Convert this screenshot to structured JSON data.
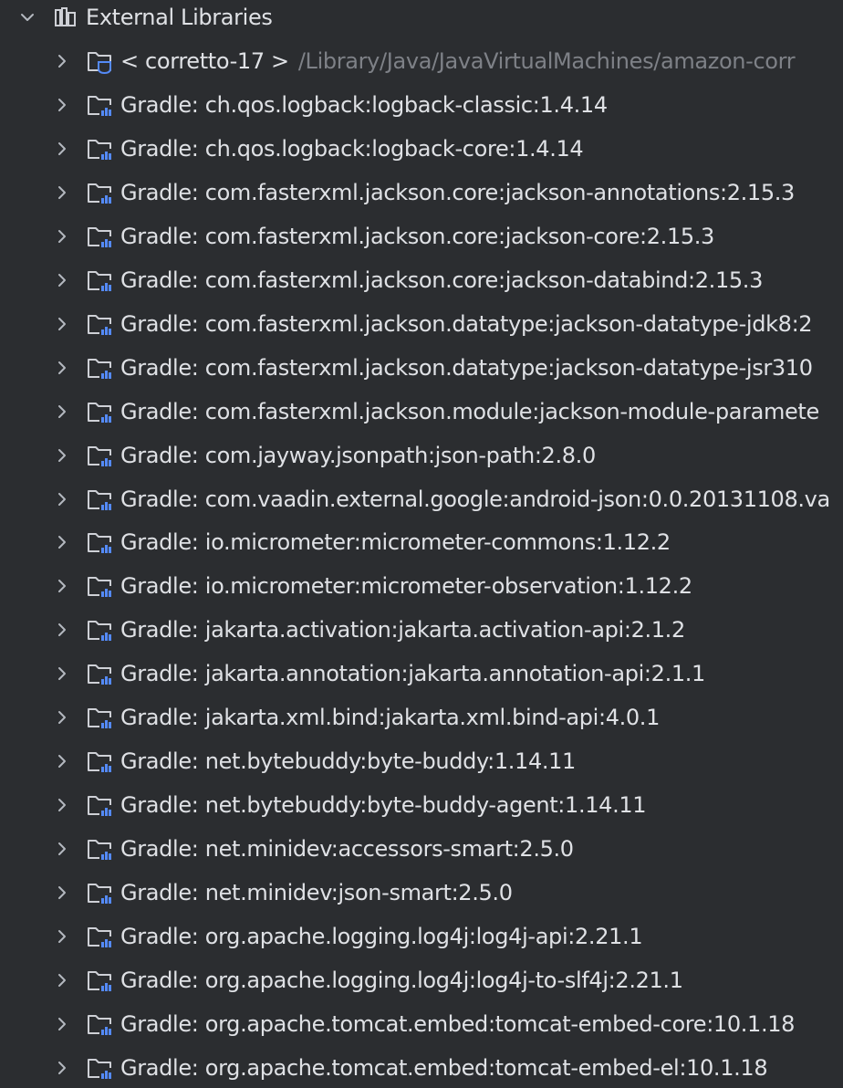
{
  "colors": {
    "background": "#2b2d30",
    "text": "#dfe1e5",
    "path_text": "#7e8187",
    "chevron": "#b4b8bf",
    "folder_outline": "#ced0d6",
    "library_accent": "#548af7"
  },
  "root": {
    "label": "External Libraries",
    "icon": "library-icon",
    "expanded": true
  },
  "items": [
    {
      "label": "< corretto-17 >",
      "path": "/Library/Java/JavaVirtualMachines/amazon-corr",
      "icon": "jdk-folder-icon"
    },
    {
      "label": "Gradle: ch.qos.logback:logback-classic:1.4.14",
      "icon": "library-folder-icon"
    },
    {
      "label": "Gradle: ch.qos.logback:logback-core:1.4.14",
      "icon": "library-folder-icon"
    },
    {
      "label": "Gradle: com.fasterxml.jackson.core:jackson-annotations:2.15.3",
      "icon": "library-folder-icon"
    },
    {
      "label": "Gradle: com.fasterxml.jackson.core:jackson-core:2.15.3",
      "icon": "library-folder-icon"
    },
    {
      "label": "Gradle: com.fasterxml.jackson.core:jackson-databind:2.15.3",
      "icon": "library-folder-icon"
    },
    {
      "label": "Gradle: com.fasterxml.jackson.datatype:jackson-datatype-jdk8:2",
      "icon": "library-folder-icon"
    },
    {
      "label": "Gradle: com.fasterxml.jackson.datatype:jackson-datatype-jsr310",
      "icon": "library-folder-icon"
    },
    {
      "label": "Gradle: com.fasterxml.jackson.module:jackson-module-paramete",
      "icon": "library-folder-icon"
    },
    {
      "label": "Gradle: com.jayway.jsonpath:json-path:2.8.0",
      "icon": "library-folder-icon"
    },
    {
      "label": "Gradle: com.vaadin.external.google:android-json:0.0.20131108.va",
      "icon": "library-folder-icon"
    },
    {
      "label": "Gradle: io.micrometer:micrometer-commons:1.12.2",
      "icon": "library-folder-icon"
    },
    {
      "label": "Gradle: io.micrometer:micrometer-observation:1.12.2",
      "icon": "library-folder-icon"
    },
    {
      "label": "Gradle: jakarta.activation:jakarta.activation-api:2.1.2",
      "icon": "library-folder-icon"
    },
    {
      "label": "Gradle: jakarta.annotation:jakarta.annotation-api:2.1.1",
      "icon": "library-folder-icon"
    },
    {
      "label": "Gradle: jakarta.xml.bind:jakarta.xml.bind-api:4.0.1",
      "icon": "library-folder-icon"
    },
    {
      "label": "Gradle: net.bytebuddy:byte-buddy:1.14.11",
      "icon": "library-folder-icon"
    },
    {
      "label": "Gradle: net.bytebuddy:byte-buddy-agent:1.14.11",
      "icon": "library-folder-icon"
    },
    {
      "label": "Gradle: net.minidev:accessors-smart:2.5.0",
      "icon": "library-folder-icon"
    },
    {
      "label": "Gradle: net.minidev:json-smart:2.5.0",
      "icon": "library-folder-icon"
    },
    {
      "label": "Gradle: org.apache.logging.log4j:log4j-api:2.21.1",
      "icon": "library-folder-icon"
    },
    {
      "label": "Gradle: org.apache.logging.log4j:log4j-to-slf4j:2.21.1",
      "icon": "library-folder-icon"
    },
    {
      "label": "Gradle: org.apache.tomcat.embed:tomcat-embed-core:10.1.18",
      "icon": "library-folder-icon"
    },
    {
      "label": "Gradle: org.apache.tomcat.embed:tomcat-embed-el:10.1.18",
      "icon": "library-folder-icon"
    }
  ]
}
